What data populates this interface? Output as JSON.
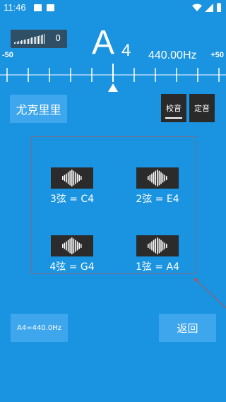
{
  "status_bar": {
    "time": "11:46"
  },
  "level_meter": {
    "value": "0"
  },
  "tuner": {
    "note": "A",
    "octave": "4",
    "frequency": "440.00Hz",
    "scale_min": "-50",
    "scale_max": "+50"
  },
  "preset_button": "尤克里里",
  "mode_tabs": [
    {
      "label": "校音",
      "selected": true
    },
    {
      "label": "定音",
      "selected": false
    }
  ],
  "strings": [
    {
      "label": "3弦 = C4"
    },
    {
      "label": "2弦 = E4"
    },
    {
      "label": "4弦 = G4"
    },
    {
      "label": "1弦 = A4"
    }
  ],
  "reference_button": "A4=440.0Hz",
  "back_button": "返回",
  "colors": {
    "background": "#1a93e0",
    "button": "#3ea6ec",
    "dark": "#2b2b2b",
    "panel_border": "#7d6c88"
  }
}
